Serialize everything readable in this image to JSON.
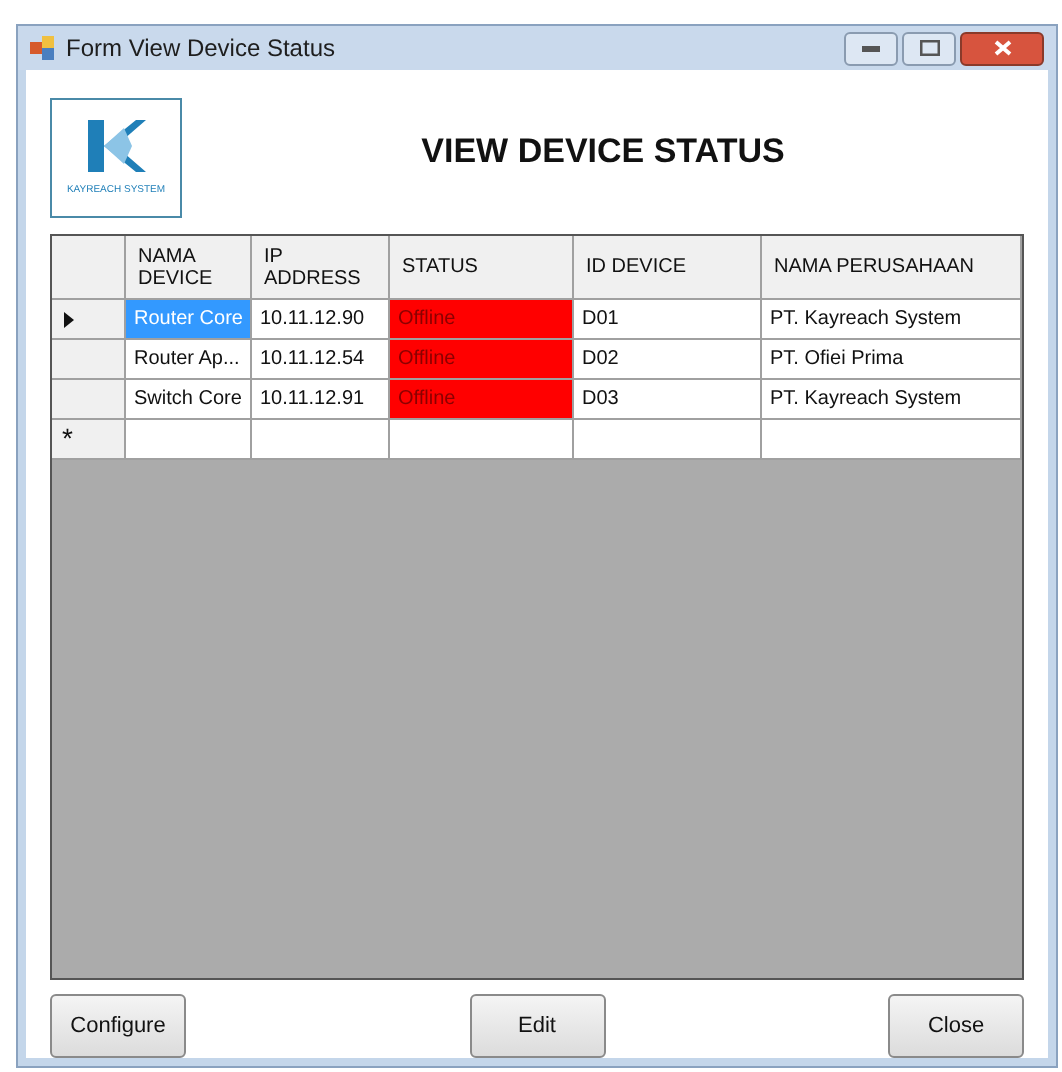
{
  "window": {
    "title": "Form View Device Status"
  },
  "logo": {
    "caption": "KAYREACH SYSTEM"
  },
  "heading": "VIEW DEVICE STATUS",
  "table": {
    "columns": [
      "NAMA DEVICE",
      "IP ADDRESS",
      "STATUS",
      "ID DEVICE",
      "NAMA PERUSAHAAN"
    ],
    "rows": [
      {
        "selected": true,
        "color": "#ff0000",
        "cells": [
          "Router Core",
          "10.11.12.90",
          "Offline",
          "D01",
          "PT. Kayreach System"
        ]
      },
      {
        "selected": false,
        "color": "#ff0000",
        "cells": [
          "Router Ap...",
          "10.11.12.54",
          "Offline",
          "D02",
          "PT. Ofiei Prima"
        ]
      },
      {
        "selected": false,
        "color": "#ff0000",
        "cells": [
          "Switch Core",
          "10.11.12.91",
          "Offline",
          "D03",
          "PT. Kayreach System"
        ]
      }
    ],
    "new_row_marker": "*"
  },
  "buttons": [
    "Configure",
    "Edit",
    "Close"
  ]
}
